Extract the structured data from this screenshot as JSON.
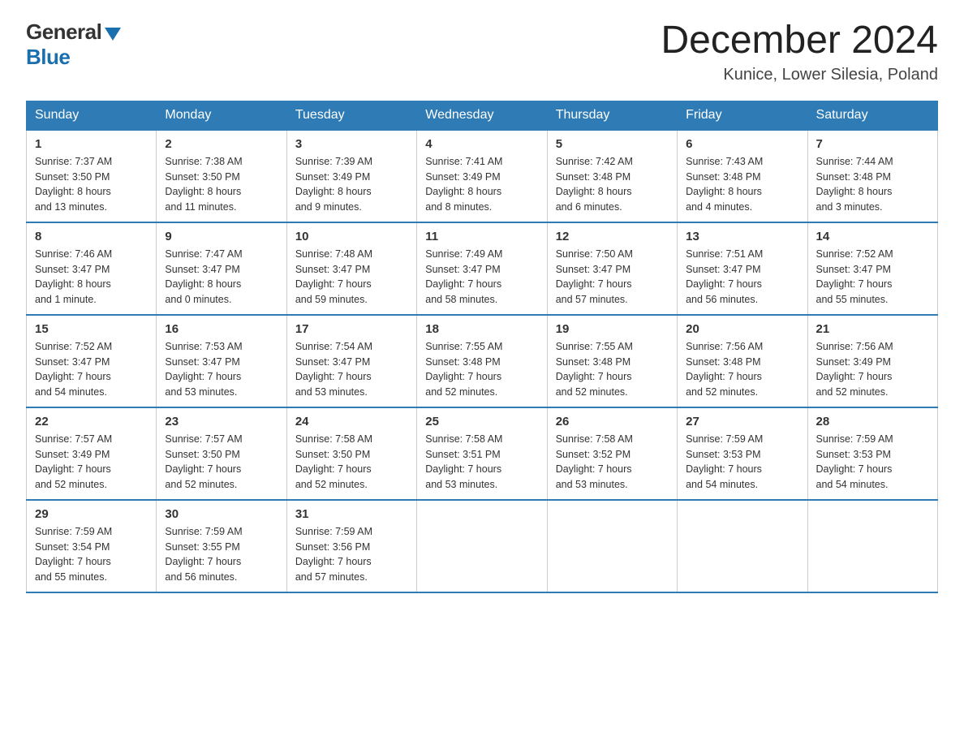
{
  "header": {
    "logo_general": "General",
    "logo_blue": "Blue",
    "month_title": "December 2024",
    "location": "Kunice, Lower Silesia, Poland"
  },
  "days_of_week": [
    "Sunday",
    "Monday",
    "Tuesday",
    "Wednesday",
    "Thursday",
    "Friday",
    "Saturday"
  ],
  "weeks": [
    [
      {
        "day": "1",
        "sunrise": "7:37 AM",
        "sunset": "3:50 PM",
        "daylight": "8 hours and 13 minutes."
      },
      {
        "day": "2",
        "sunrise": "7:38 AM",
        "sunset": "3:50 PM",
        "daylight": "8 hours and 11 minutes."
      },
      {
        "day": "3",
        "sunrise": "7:39 AM",
        "sunset": "3:49 PM",
        "daylight": "8 hours and 9 minutes."
      },
      {
        "day": "4",
        "sunrise": "7:41 AM",
        "sunset": "3:49 PM",
        "daylight": "8 hours and 8 minutes."
      },
      {
        "day": "5",
        "sunrise": "7:42 AM",
        "sunset": "3:48 PM",
        "daylight": "8 hours and 6 minutes."
      },
      {
        "day": "6",
        "sunrise": "7:43 AM",
        "sunset": "3:48 PM",
        "daylight": "8 hours and 4 minutes."
      },
      {
        "day": "7",
        "sunrise": "7:44 AM",
        "sunset": "3:48 PM",
        "daylight": "8 hours and 3 minutes."
      }
    ],
    [
      {
        "day": "8",
        "sunrise": "7:46 AM",
        "sunset": "3:47 PM",
        "daylight": "8 hours and 1 minute."
      },
      {
        "day": "9",
        "sunrise": "7:47 AM",
        "sunset": "3:47 PM",
        "daylight": "8 hours and 0 minutes."
      },
      {
        "day": "10",
        "sunrise": "7:48 AM",
        "sunset": "3:47 PM",
        "daylight": "7 hours and 59 minutes."
      },
      {
        "day": "11",
        "sunrise": "7:49 AM",
        "sunset": "3:47 PM",
        "daylight": "7 hours and 58 minutes."
      },
      {
        "day": "12",
        "sunrise": "7:50 AM",
        "sunset": "3:47 PM",
        "daylight": "7 hours and 57 minutes."
      },
      {
        "day": "13",
        "sunrise": "7:51 AM",
        "sunset": "3:47 PM",
        "daylight": "7 hours and 56 minutes."
      },
      {
        "day": "14",
        "sunrise": "7:52 AM",
        "sunset": "3:47 PM",
        "daylight": "7 hours and 55 minutes."
      }
    ],
    [
      {
        "day": "15",
        "sunrise": "7:52 AM",
        "sunset": "3:47 PM",
        "daylight": "7 hours and 54 minutes."
      },
      {
        "day": "16",
        "sunrise": "7:53 AM",
        "sunset": "3:47 PM",
        "daylight": "7 hours and 53 minutes."
      },
      {
        "day": "17",
        "sunrise": "7:54 AM",
        "sunset": "3:47 PM",
        "daylight": "7 hours and 53 minutes."
      },
      {
        "day": "18",
        "sunrise": "7:55 AM",
        "sunset": "3:48 PM",
        "daylight": "7 hours and 52 minutes."
      },
      {
        "day": "19",
        "sunrise": "7:55 AM",
        "sunset": "3:48 PM",
        "daylight": "7 hours and 52 minutes."
      },
      {
        "day": "20",
        "sunrise": "7:56 AM",
        "sunset": "3:48 PM",
        "daylight": "7 hours and 52 minutes."
      },
      {
        "day": "21",
        "sunrise": "7:56 AM",
        "sunset": "3:49 PM",
        "daylight": "7 hours and 52 minutes."
      }
    ],
    [
      {
        "day": "22",
        "sunrise": "7:57 AM",
        "sunset": "3:49 PM",
        "daylight": "7 hours and 52 minutes."
      },
      {
        "day": "23",
        "sunrise": "7:57 AM",
        "sunset": "3:50 PM",
        "daylight": "7 hours and 52 minutes."
      },
      {
        "day": "24",
        "sunrise": "7:58 AM",
        "sunset": "3:50 PM",
        "daylight": "7 hours and 52 minutes."
      },
      {
        "day": "25",
        "sunrise": "7:58 AM",
        "sunset": "3:51 PM",
        "daylight": "7 hours and 53 minutes."
      },
      {
        "day": "26",
        "sunrise": "7:58 AM",
        "sunset": "3:52 PM",
        "daylight": "7 hours and 53 minutes."
      },
      {
        "day": "27",
        "sunrise": "7:59 AM",
        "sunset": "3:53 PM",
        "daylight": "7 hours and 54 minutes."
      },
      {
        "day": "28",
        "sunrise": "7:59 AM",
        "sunset": "3:53 PM",
        "daylight": "7 hours and 54 minutes."
      }
    ],
    [
      {
        "day": "29",
        "sunrise": "7:59 AM",
        "sunset": "3:54 PM",
        "daylight": "7 hours and 55 minutes."
      },
      {
        "day": "30",
        "sunrise": "7:59 AM",
        "sunset": "3:55 PM",
        "daylight": "7 hours and 56 minutes."
      },
      {
        "day": "31",
        "sunrise": "7:59 AM",
        "sunset": "3:56 PM",
        "daylight": "7 hours and 57 minutes."
      },
      null,
      null,
      null,
      null
    ]
  ],
  "labels": {
    "sunrise": "Sunrise:",
    "sunset": "Sunset:",
    "daylight": "Daylight:"
  }
}
